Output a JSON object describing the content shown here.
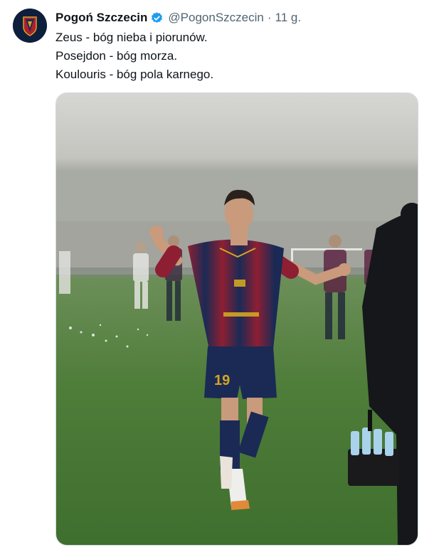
{
  "account": {
    "name": "Pogoń Szczecin",
    "handle": "@PogonSzczecin",
    "separator": "·",
    "time": "11 g."
  },
  "tweet": {
    "lines": [
      "Zeus - bóg nieba i piorunów.",
      "Posejdon - bóg morza.",
      "Koulouris - bóg pola karnego."
    ]
  },
  "photo": {
    "player_number": "19",
    "colors": {
      "navy": "#1a2a55",
      "maroon": "#8e1f33",
      "grass": "#4e7a38",
      "fog": "#c9c9c4",
      "verified_blue": "#1d9bf0"
    }
  }
}
